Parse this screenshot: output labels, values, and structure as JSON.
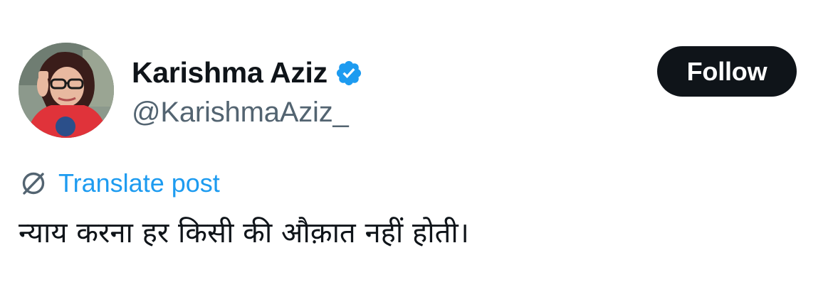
{
  "user": {
    "display_name": "Karishma Aziz",
    "handle": "@KarishmaAziz_",
    "verified": true,
    "avatar_icon": "profile-photo"
  },
  "actions": {
    "follow_label": "Follow"
  },
  "translate": {
    "label": "Translate post",
    "icon": "globe-translate-icon"
  },
  "post": {
    "text": "न्याय करना हर किसी की औक़ात नहीं होती।"
  },
  "colors": {
    "accent": "#1d9bf0",
    "text_primary": "#0f1419",
    "text_secondary": "#536471",
    "button_bg": "#0f1419",
    "button_text": "#ffffff"
  }
}
